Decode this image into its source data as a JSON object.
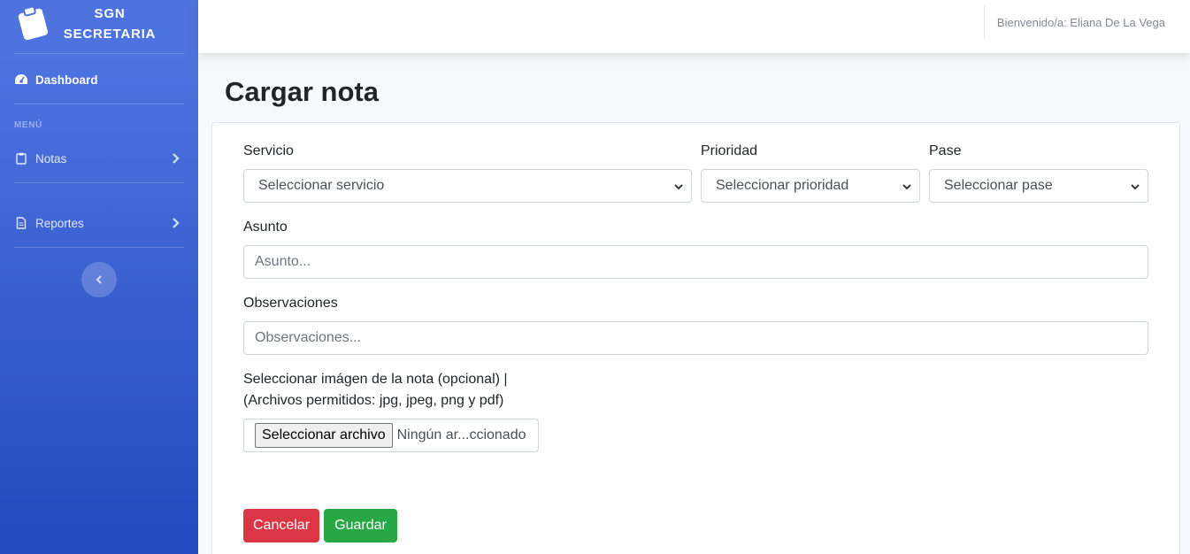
{
  "brand": {
    "line1": "SGN",
    "line2": "SECRETARIA",
    "icon": "clipboard-icon"
  },
  "sidebar": {
    "dashboard": {
      "label": "Dashboard",
      "icon": "tachometer-icon"
    },
    "heading": "MENÚ",
    "items": [
      {
        "label": "Notas",
        "icon": "clipboard-icon"
      },
      {
        "label": "Reportes",
        "icon": "file-icon"
      }
    ]
  },
  "topbar": {
    "user_greeting": "Bienvenido/a: Eliana De La Vega"
  },
  "page": {
    "title": "Cargar nota"
  },
  "form": {
    "servicio": {
      "label": "Servicio",
      "selected": "Seleccionar servicio"
    },
    "prioridad": {
      "label": "Prioridad",
      "selected": "Seleccionar prioridad"
    },
    "pase": {
      "label": "Pase",
      "selected": "Seleccionar pase"
    },
    "asunto": {
      "label": "Asunto",
      "placeholder": "Asunto..."
    },
    "observaciones": {
      "label": "Observaciones",
      "placeholder": "Observaciones..."
    },
    "archivo": {
      "label_line1": "Seleccionar imágen de la nota (opcional) |",
      "label_line2": "(Archivos permitidos: jpg, jpeg, png y pdf)",
      "button": "Seleccionar archivo",
      "filename": "Ningún ar...ccionado"
    },
    "cancel": "Cancelar",
    "save": "Guardar"
  },
  "colors": {
    "sidebar_top": "#4e73df",
    "sidebar_bottom": "#224abe",
    "cancel": "#dc3545",
    "save": "#28a745"
  }
}
